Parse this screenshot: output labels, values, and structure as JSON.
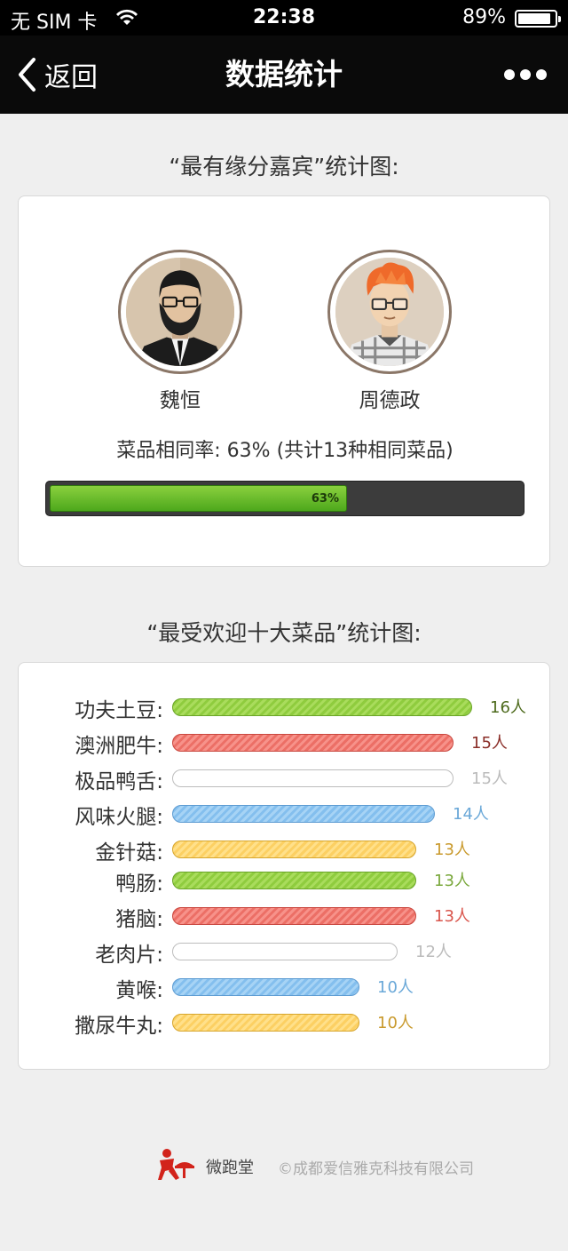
{
  "status_bar": {
    "carrier": "无 SIM 卡",
    "time": "22:38",
    "battery": "89%",
    "battery_level": 0.89
  },
  "nav": {
    "back_label": "返回",
    "title": "数据统计"
  },
  "guests_section": {
    "title": "“最有缘分嘉宾”统计图:",
    "guests": [
      {
        "name": "魏恒"
      },
      {
        "name": "周德政"
      }
    ],
    "similarity_text": "菜品相同率: 63% (共计13种相同菜品)",
    "progress_label": "63%",
    "progress_value": 0.63
  },
  "dishes_section": {
    "title": "“最受欢迎十大菜品”统计图:",
    "max_count": 16,
    "colors": {
      "green": "#8fcc3e",
      "red": "#ec6f66",
      "white": "#ffffff",
      "blue": "#84bfee",
      "yellow": "#fcd063"
    },
    "dishes": [
      {
        "name": "功夫土豆:",
        "count": 16,
        "label": "16人",
        "color": "green",
        "text_color": "#4d6a1c"
      },
      {
        "name": "澳洲肥牛:",
        "count": 15,
        "label": "15人",
        "color": "red",
        "text_color": "#8a2d27"
      },
      {
        "name": "极品鸭舌:",
        "count": 15,
        "label": "15人",
        "color": "white",
        "text_color": "#bbbbbb"
      },
      {
        "name": "风味火腿:",
        "count": 14,
        "label": "14人",
        "color": "blue",
        "text_color": "#6aa8d8"
      },
      {
        "name": "金针菇:",
        "count": 13,
        "label": "13人",
        "color": "yellow",
        "text_color": "#c99a2e"
      },
      {
        "name": "鸭肠:",
        "count": 13,
        "label": "13人",
        "color": "green",
        "text_color": "#7aa83c"
      },
      {
        "name": "猪脑:",
        "count": 13,
        "label": "13人",
        "color": "red",
        "text_color": "#d9554c"
      },
      {
        "name": "老肉片:",
        "count": 12,
        "label": "12人",
        "color": "white",
        "text_color": "#bbbbbb"
      },
      {
        "name": "黄喉:",
        "count": 10,
        "label": "10人",
        "color": "blue",
        "text_color": "#6aa8d8"
      },
      {
        "name": "撒尿牛丸:",
        "count": 10,
        "label": "10人",
        "color": "yellow",
        "text_color": "#c99a2e"
      }
    ]
  },
  "footer": {
    "brand": "微跑堂",
    "copyright": "©成都爱信雅克科技有限公司"
  }
}
